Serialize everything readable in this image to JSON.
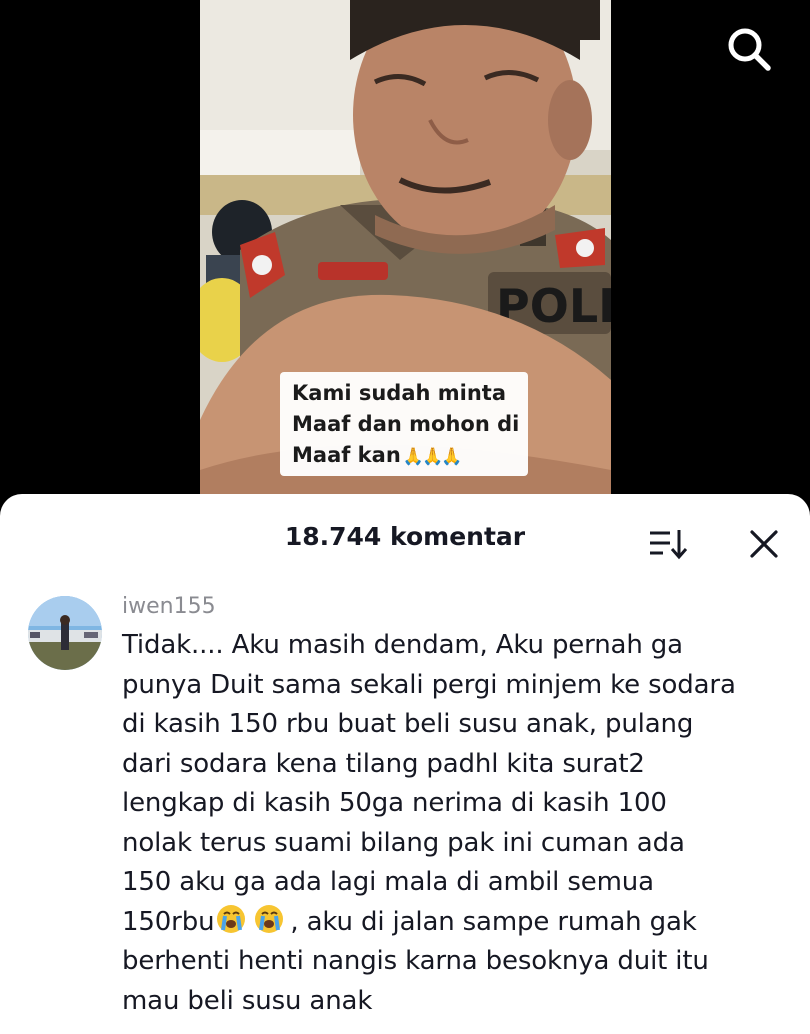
{
  "video": {
    "caption_lines": [
      "Kami sudah minta",
      "Maaf dan mohon di",
      "Maaf kan"
    ],
    "caption_emoji": "🙏🙏🙏",
    "uniform_text": "POLI",
    "search_icon": "search-icon"
  },
  "comments_sheet": {
    "title": "18.744 komentar",
    "sort_icon": "sort-icon",
    "close_icon": "close-icon"
  },
  "comment": {
    "username": "iwen155",
    "lines": [
      "Tidak.... Aku masih dendam, Aku pernah ga",
      "punya Duit sama sekali pergi minjem ke sodara",
      "di kasih 150 rbu buat beli susu anak, pulang",
      "dari sodara kena tilang padhl kita surat2",
      "lengkap di kasih 50ga nerima di kasih 100",
      "nolak terus suami bilang pak ini cuman ada",
      "150 aku ga ada lagi mala di ambil semua"
    ],
    "line8_start": "150rbu",
    "line8_end": ", aku di jalan sampe rumah gak",
    "line9": "berhenti henti nangis karna besoknya duit itu",
    "line10": "mau beli susu anak",
    "emoji_icon": "crying-face-icon"
  },
  "colors": {
    "sheet_bg": "#ffffff",
    "text_primary": "#161823",
    "text_secondary": "#8a8b91"
  }
}
